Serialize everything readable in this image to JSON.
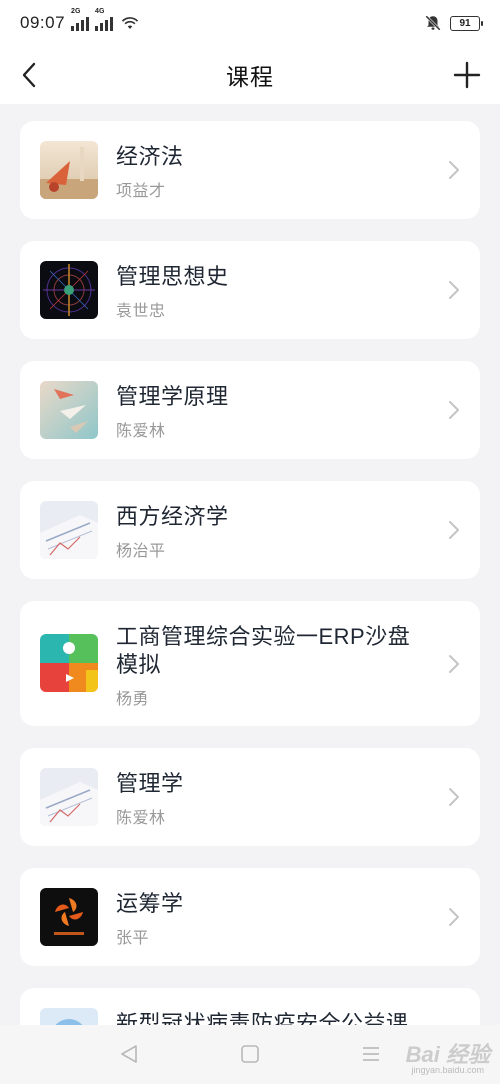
{
  "status_bar": {
    "time": "09:07",
    "signal1_tag": "2G",
    "signal2_tag": "4G",
    "battery": "91"
  },
  "nav": {
    "title": "课程"
  },
  "courses": [
    {
      "name": "经济法",
      "teacher": "项益才"
    },
    {
      "name": "管理思想史",
      "teacher": "袁世忠"
    },
    {
      "name": "管理学原理",
      "teacher": "陈爱林"
    },
    {
      "name": "西方经济学",
      "teacher": "杨治平"
    },
    {
      "name": "工商管理综合实验一ERP沙盘模拟",
      "teacher": "杨勇"
    },
    {
      "name": "管理学",
      "teacher": "陈爱林"
    },
    {
      "name": "运筹学",
      "teacher": "张平"
    },
    {
      "name": "新型冠状病毒防疫安全公益课",
      "teacher": ""
    }
  ],
  "watermark": {
    "text": "Bai 经验",
    "sub": "jingyan.baidu.com"
  },
  "colors": {
    "background": "#f3f3f5",
    "card": "#ffffff",
    "title_text": "#1f2733",
    "subtitle_text": "#999999"
  }
}
